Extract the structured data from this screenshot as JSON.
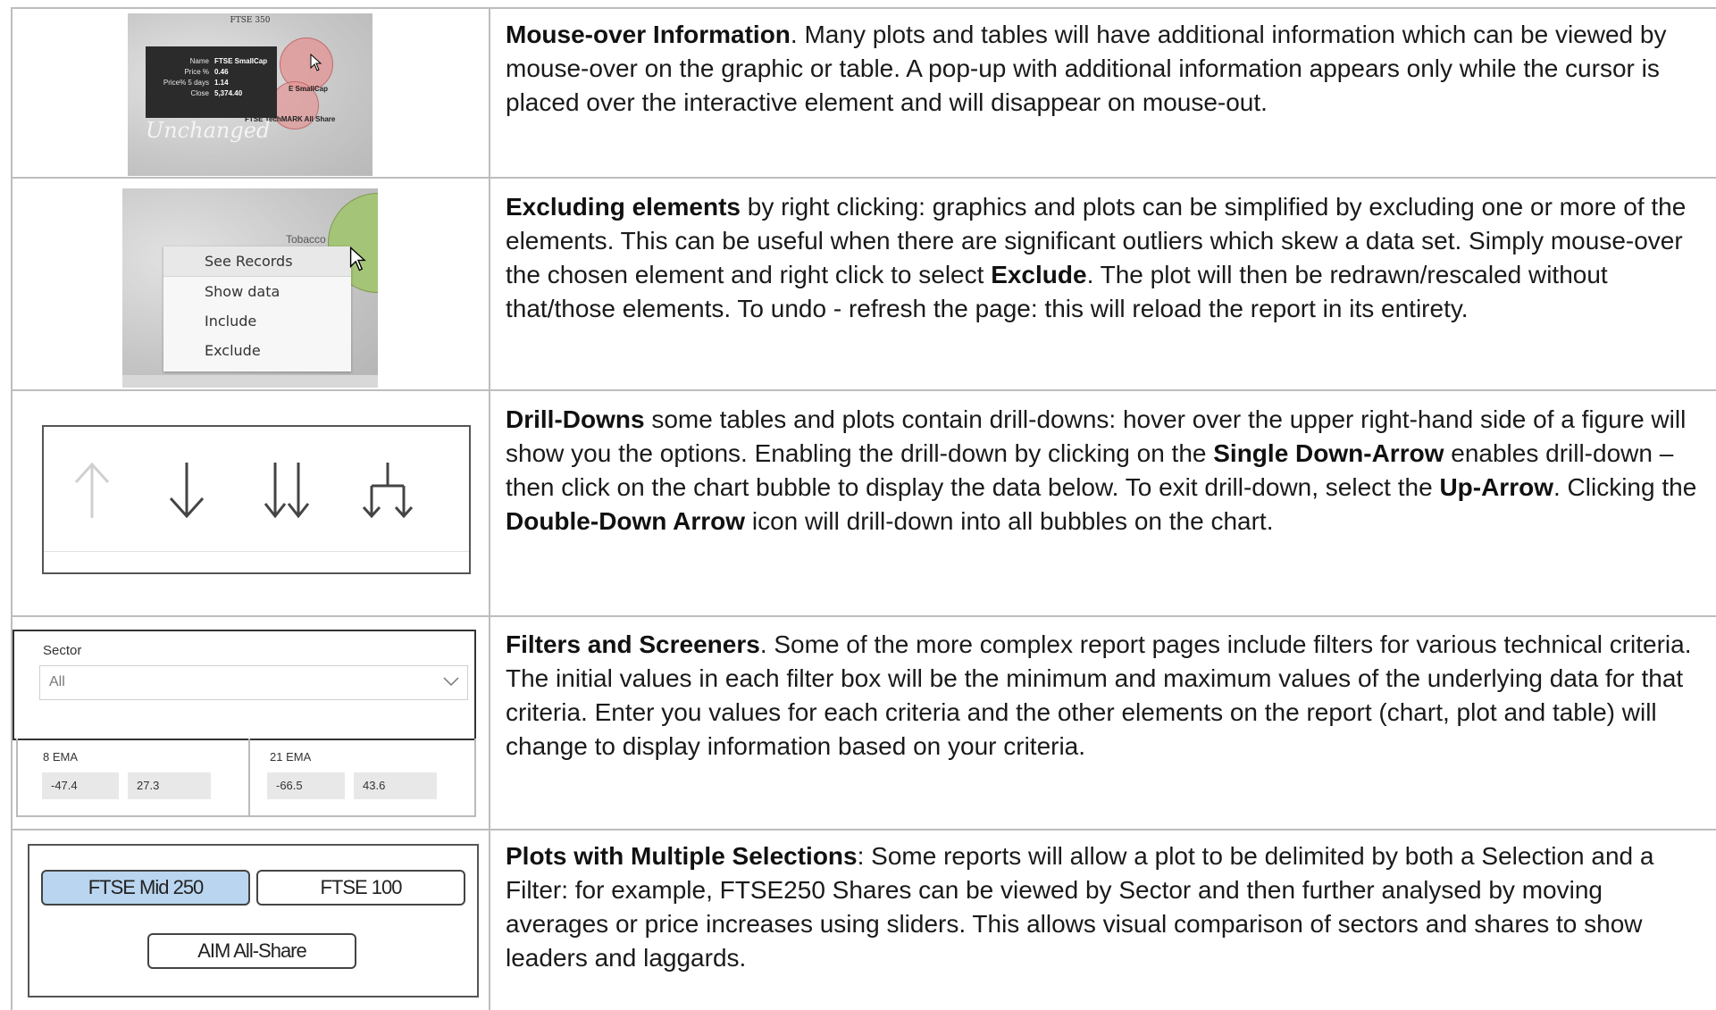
{
  "rows": [
    {
      "title": "Mouse-over Information",
      "text": ". Many plots and tables will have additional information which can be viewed by mouse-over on the graphic or table. A pop-up with additional information appears only while the cursor is placed over the interactive element and will disappear on mouse-out.",
      "thumb": {
        "chart_title": "FTSE 350",
        "tooltip": [
          {
            "key": "Name",
            "value": "FTSE SmallCap"
          },
          {
            "key": "Price %",
            "value": "0.46"
          },
          {
            "key": "Price% 5 days",
            "value": "1.14"
          },
          {
            "key": "Close",
            "value": "5,374.40"
          }
        ],
        "label_smallcap": "E SmallCap",
        "label_techmark": "FTSE TechMARK All Share",
        "watermark": "Unchanged"
      }
    },
    {
      "title": "Excluding elements",
      "text_a": " by right clicking: graphics and plots can be simplified by excluding one or more of the elements. This can be useful when there are significant outliers which skew a data set. Simply mouse-over the chosen element and right click to select ",
      "bold_b": "Exclude",
      "text_c": ". The plot will then be redrawn/rescaled without that/those elements. To undo - refresh the page: this will reload the report in its entirety.",
      "thumb": {
        "bubble_label": "Tobacco",
        "menu": [
          "See Records",
          "Show data",
          "Include",
          "Exclude"
        ]
      }
    },
    {
      "title": "Drill-Downs",
      "text_a": " some tables and plots contain drill-downs: hover over the upper right-hand side of a figure will show you the options. Enabling the drill-down by clicking on the ",
      "bold_b": "Single Down-Arrow",
      "text_c": " enables drill-down – then click on the chart bubble to display the data below. To exit drill-down, select the ",
      "bold_d": "Up-Arrow",
      "text_e": ". Clicking the ",
      "bold_f": "Double-Down Arrow",
      "text_g": " icon will drill-down into all bubbles on the chart."
    },
    {
      "title": "Filters and Screeners",
      "text": ". Some of the more complex report pages include filters for various technical criteria. The initial values in each filter box will be the minimum and maximum values of the underlying data for that criteria. Enter you values for each criteria and the other elements on the report (chart, plot and table) will change to display information based on your criteria.",
      "thumb": {
        "sector_label": "Sector",
        "sector_value": "All",
        "ema8_label": "8 EMA",
        "ema8_min": "-47.4",
        "ema8_max": "27.3",
        "ema21_label": "21 EMA",
        "ema21_min": "-66.5",
        "ema21_max": "43.6"
      }
    },
    {
      "title": "Plots with Multiple Selections",
      "text": ": Some reports will allow a plot to be delimited by both a Selection and a Filter: for example, FTSE250 Shares can be viewed by Sector and then further analysed by moving averages or price increases using sliders. This allows visual comparison of sectors and shares to show leaders and laggards.",
      "thumb": {
        "buttons": [
          "FTSE Mid 250",
          "FTSE 100",
          "AIM All-Share"
        ],
        "selected": "FTSE Mid 250"
      }
    }
  ],
  "colors": {
    "grid": "#bdbdbd",
    "selected_button": "#b9d5ef",
    "bubble_red": "#e29696",
    "bubble_green": "#a4c477"
  }
}
